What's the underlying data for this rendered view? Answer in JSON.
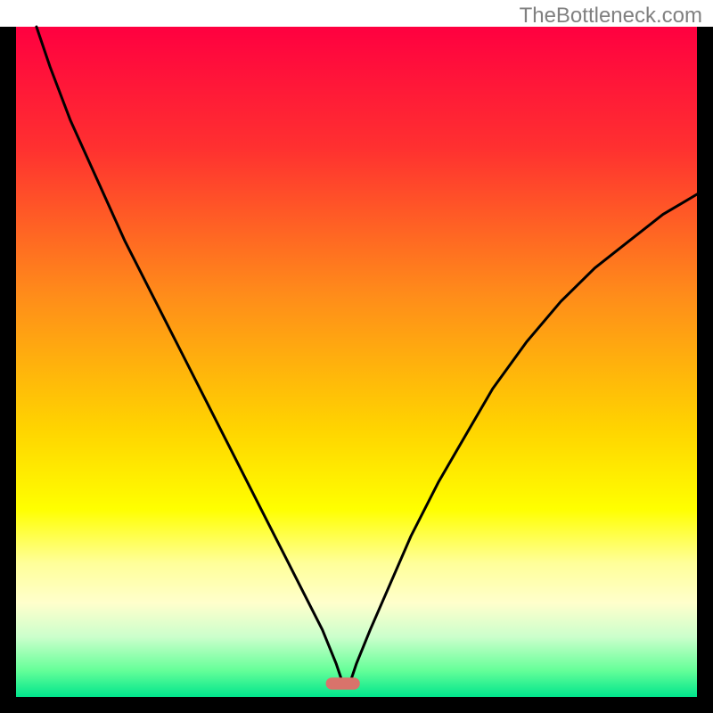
{
  "watermark": "TheBottleneck.com",
  "chart_data": {
    "type": "line",
    "title": "",
    "xlabel": "",
    "ylabel": "",
    "xlim": [
      0,
      100
    ],
    "ylim": [
      0,
      100
    ],
    "axes": {
      "left": true,
      "right": true,
      "top": false,
      "bottom": true,
      "color": "#000000"
    },
    "background_gradient": {
      "stops": [
        {
          "offset": 0.0,
          "color": "#ff0040"
        },
        {
          "offset": 0.18,
          "color": "#ff3030"
        },
        {
          "offset": 0.4,
          "color": "#ff8c1a"
        },
        {
          "offset": 0.6,
          "color": "#ffd400"
        },
        {
          "offset": 0.72,
          "color": "#ffff00"
        },
        {
          "offset": 0.8,
          "color": "#ffff99"
        },
        {
          "offset": 0.86,
          "color": "#ffffcc"
        },
        {
          "offset": 0.91,
          "color": "#ccffcc"
        },
        {
          "offset": 0.96,
          "color": "#66ff99"
        },
        {
          "offset": 1.0,
          "color": "#00e58c"
        }
      ]
    },
    "marker": {
      "x": 48,
      "y": 2,
      "color": "#d9736b",
      "width": 5,
      "height": 2
    },
    "series": [
      {
        "name": "bottleneck-curve",
        "color": "#000000",
        "x": [
          3,
          5,
          8,
          12,
          16,
          20,
          24,
          28,
          32,
          36,
          40,
          43,
          45,
          47,
          48,
          49,
          50,
          52,
          55,
          58,
          62,
          66,
          70,
          75,
          80,
          85,
          90,
          95,
          100
        ],
        "y": [
          100,
          94,
          86,
          77,
          68,
          60,
          52,
          44,
          36,
          28,
          20,
          14,
          10,
          5,
          2,
          2,
          5,
          10,
          17,
          24,
          32,
          39,
          46,
          53,
          59,
          64,
          68,
          72,
          75
        ]
      }
    ]
  }
}
